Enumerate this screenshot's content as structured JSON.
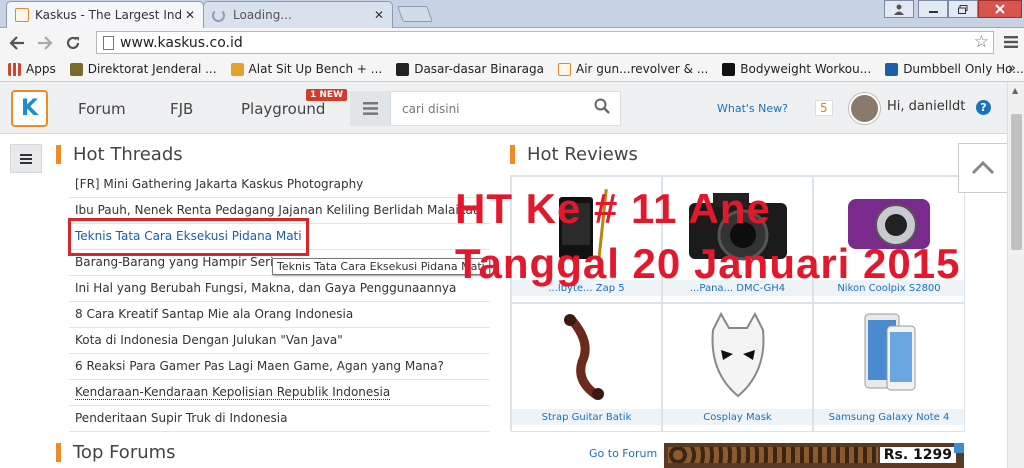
{
  "browser": {
    "tabs": [
      {
        "title": "Kaskus - The Largest Indo",
        "close": "✕"
      },
      {
        "title": "Loading...",
        "close": "✕"
      }
    ],
    "url": "www.kaskus.co.id",
    "bookmarks": [
      {
        "label": "Apps",
        "icon": "apps-grid-icon",
        "color": "#d6402c"
      },
      {
        "label": "Direktorat Jenderal ...",
        "icon": "emblem-icon",
        "color": "#7a6a2a"
      },
      {
        "label": "Alat Sit Up Bench + ...",
        "icon": "tag-icon",
        "color": "#e5a12b"
      },
      {
        "label": "Dasar-dasar Binaraga",
        "icon": "runner-icon",
        "color": "#222222"
      },
      {
        "label": "Air gun...revolver & ...",
        "icon": "kaskus-icon",
        "color": "#e08a2e"
      },
      {
        "label": "Bodyweight Workou...",
        "icon": "df-icon",
        "color": "#111111"
      },
      {
        "label": "Dumbbell Only Ho...",
        "icon": "ms-icon",
        "color": "#1a5fa8"
      }
    ],
    "bookmarks_more": "»"
  },
  "header": {
    "logo": "K",
    "nav": [
      "Forum",
      "FJB",
      "Playground"
    ],
    "new_badge": "1 NEW",
    "search_placeholder": "cari disini",
    "whats_new": "What's New?",
    "notif_count": "5",
    "greeting": "Hi, danielldt",
    "help": "?"
  },
  "hot_threads": {
    "title": "Hot Threads",
    "items": [
      "[FR] Mini Gathering Jakarta Kaskus Photography",
      "Ibu Pauh, Nenek Renta Pedagang Jajanan Keliling Berlidah Malaikat",
      "Teknis Tata Cara Eksekusi Pidana Mati",
      "Barang-Barang yang Hampir Sering",
      "Ini Hal yang Berubah Fungsi, Makna, dan Gaya Penggunaannya",
      "8 Cara Kreatif Santap Mie ala Orang Indonesia",
      "Kota di Indonesia Dengan Julukan \"Van Java\"",
      "6 Reaksi Para Gamer Pas Lagi Maen Game, Agan yang Mana?",
      "Kendaraan-Kendaraan Kepolisian Republik Indonesia",
      "Penderitaan Supir Truk di Indonesia"
    ],
    "tooltip": "Teknis Tata Cara Eksekusi Pidana Mati"
  },
  "hot_reviews": {
    "title": "Hot Reviews",
    "items": [
      {
        "caption": "...lbyte... Zap 5"
      },
      {
        "caption": "...Pana... DMC-GH4"
      },
      {
        "caption": "Nikon Coolpix S2800"
      },
      {
        "caption": "Strap Guitar Batik"
      },
      {
        "caption": "Cosplay Mask"
      },
      {
        "caption": "Samsung Galaxy Note 4"
      }
    ]
  },
  "top_forums": {
    "title": "Top Forums",
    "go_to": "Go to Forum"
  },
  "ad": {
    "price": "Rs. 1299"
  },
  "overlay": {
    "line1": "HT Ke # 11 Ane",
    "line2": "Tanggal 20 Januari 2015"
  },
  "colors": {
    "overlay": "#e3182d",
    "accent": "#f08c1f",
    "link": "#1a72b8"
  }
}
